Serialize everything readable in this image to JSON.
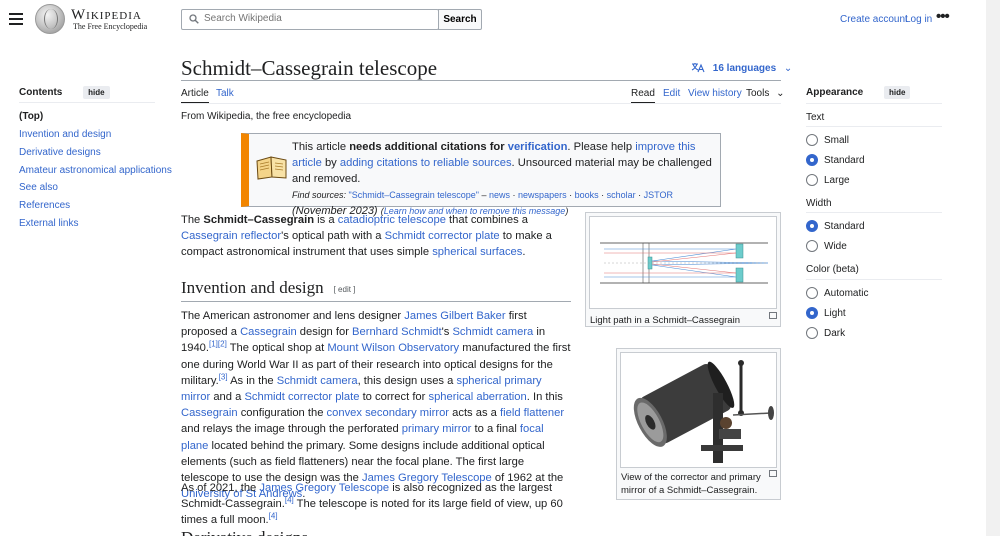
{
  "header": {
    "wordmark": "Wikipedia",
    "tagline": "The Free Encyclopedia",
    "search_placeholder": "Search Wikipedia",
    "search_button": "Search",
    "create_account": "Create account",
    "log_in": "Log in",
    "more": "•••"
  },
  "toc": {
    "title": "Contents",
    "hide": "hide",
    "items": [
      "(Top)",
      "Invention and design",
      "Derivative designs",
      "Amateur astronomical applications",
      "See also",
      "References",
      "External links"
    ]
  },
  "article": {
    "title": "Schmidt–Cassegrain telescope",
    "languages": "16 languages",
    "tabs_left": [
      "Article",
      "Talk"
    ],
    "tabs_right": [
      "Read",
      "Edit",
      "View history",
      "Tools"
    ],
    "from": "From Wikipedia, the free encyclopedia",
    "ambox": {
      "t1": "This article ",
      "t2": "needs additional citations for ",
      "t3": "verification",
      "t4": ". Please help ",
      "t5": "improve this article",
      "t6": " by ",
      "t7": "adding citations to reliable sources",
      "t8": ". Unsourced material may be challenged and removed.",
      "find": "Find sources:",
      "q": "\"Schmidt–Cassegrain telescope\"",
      "dash": " – ",
      "s1": "news",
      "s2": "newspapers",
      "s3": "books",
      "s4": "scholar",
      "s5": "JSTOR",
      "sep": " · ",
      "date": "(November 2023)",
      "learn": "Learn how and when to remove this message"
    },
    "intro": {
      "a": "The ",
      "b": "Schmidt–Cassegrain",
      "c": " is a ",
      "d": "catadioptric telescope",
      "e": " that combines a ",
      "f": "Cassegrain reflector",
      "g": "'s optical path with a ",
      "h": "Schmidt corrector plate",
      "i": " to make a compact astronomical instrument that uses simple ",
      "j": "spherical surfaces",
      "k": "."
    },
    "section1": {
      "heading": "Invention and design",
      "edit": "[ edit ]",
      "p1": [
        {
          "t": "The American astronomer and lens designer "
        },
        {
          "l": "James Gilbert Baker"
        },
        {
          "t": " first proposed a "
        },
        {
          "l": "Cassegrain"
        },
        {
          "t": " design for "
        },
        {
          "l": "Bernhard Schmidt"
        },
        {
          "t": "'s "
        },
        {
          "l": "Schmidt camera"
        },
        {
          "t": " in 1940."
        },
        {
          "s": "[1][2]"
        },
        {
          "t": " The optical shop at "
        },
        {
          "l": "Mount Wilson Observatory"
        },
        {
          "t": " manufactured the first one during World War II as part of their research into optical designs for the military."
        },
        {
          "s": "[3]"
        },
        {
          "t": " As in the "
        },
        {
          "l": "Schmidt camera"
        },
        {
          "t": ", this design uses a "
        },
        {
          "l": "spherical primary mirror"
        },
        {
          "t": " and a "
        },
        {
          "l": "Schmidt corrector plate"
        },
        {
          "t": " to correct for "
        },
        {
          "l": "spherical aberration"
        },
        {
          "t": ". In this "
        },
        {
          "l": "Cassegrain"
        },
        {
          "t": " configuration the "
        },
        {
          "l": "convex secondary mirror"
        },
        {
          "t": " acts as a "
        },
        {
          "l": "field flattener"
        },
        {
          "t": " and relays the image through the perforated "
        },
        {
          "l": "primary mirror"
        },
        {
          "t": " to a final "
        },
        {
          "l": "focal plane"
        },
        {
          "t": " located behind the primary. Some designs include additional optical elements (such as field flatteners) near the focal plane. The first large telescope to use the design was the "
        },
        {
          "l": "James Gregory Telescope"
        },
        {
          "t": " of 1962 at the "
        },
        {
          "l": "University of St Andrews"
        },
        {
          "t": "."
        }
      ],
      "p2": [
        {
          "t": "As of 2021, the "
        },
        {
          "l": "James Gregory Telescope"
        },
        {
          "t": " is also recognized as the largest Schmidt-Cassegrain."
        },
        {
          "s": "[4]"
        },
        {
          "t": " The telescope is noted for its large field of view, up 60 times a full moon."
        },
        {
          "s": "[4]"
        }
      ]
    },
    "next_heading": "Derivative designs",
    "figure1_caption": "Light path in a Schmidt–Cassegrain",
    "figure2_caption": "View of the corrector and primary mirror of a Schmidt–Cassegrain."
  },
  "appearance": {
    "title": "Appearance",
    "hide": "hide",
    "text_label": "Text",
    "text_options": [
      "Small",
      "Standard",
      "Large"
    ],
    "text_selected": 1,
    "width_label": "Width",
    "width_options": [
      "Standard",
      "Wide"
    ],
    "width_selected": 0,
    "color_label": "Color (beta)",
    "color_options": [
      "Automatic",
      "Light",
      "Dark"
    ],
    "color_selected": 1
  },
  "colors": {
    "link": "#3366cc",
    "ambox_accent": "#f28500",
    "text": "#202122"
  }
}
